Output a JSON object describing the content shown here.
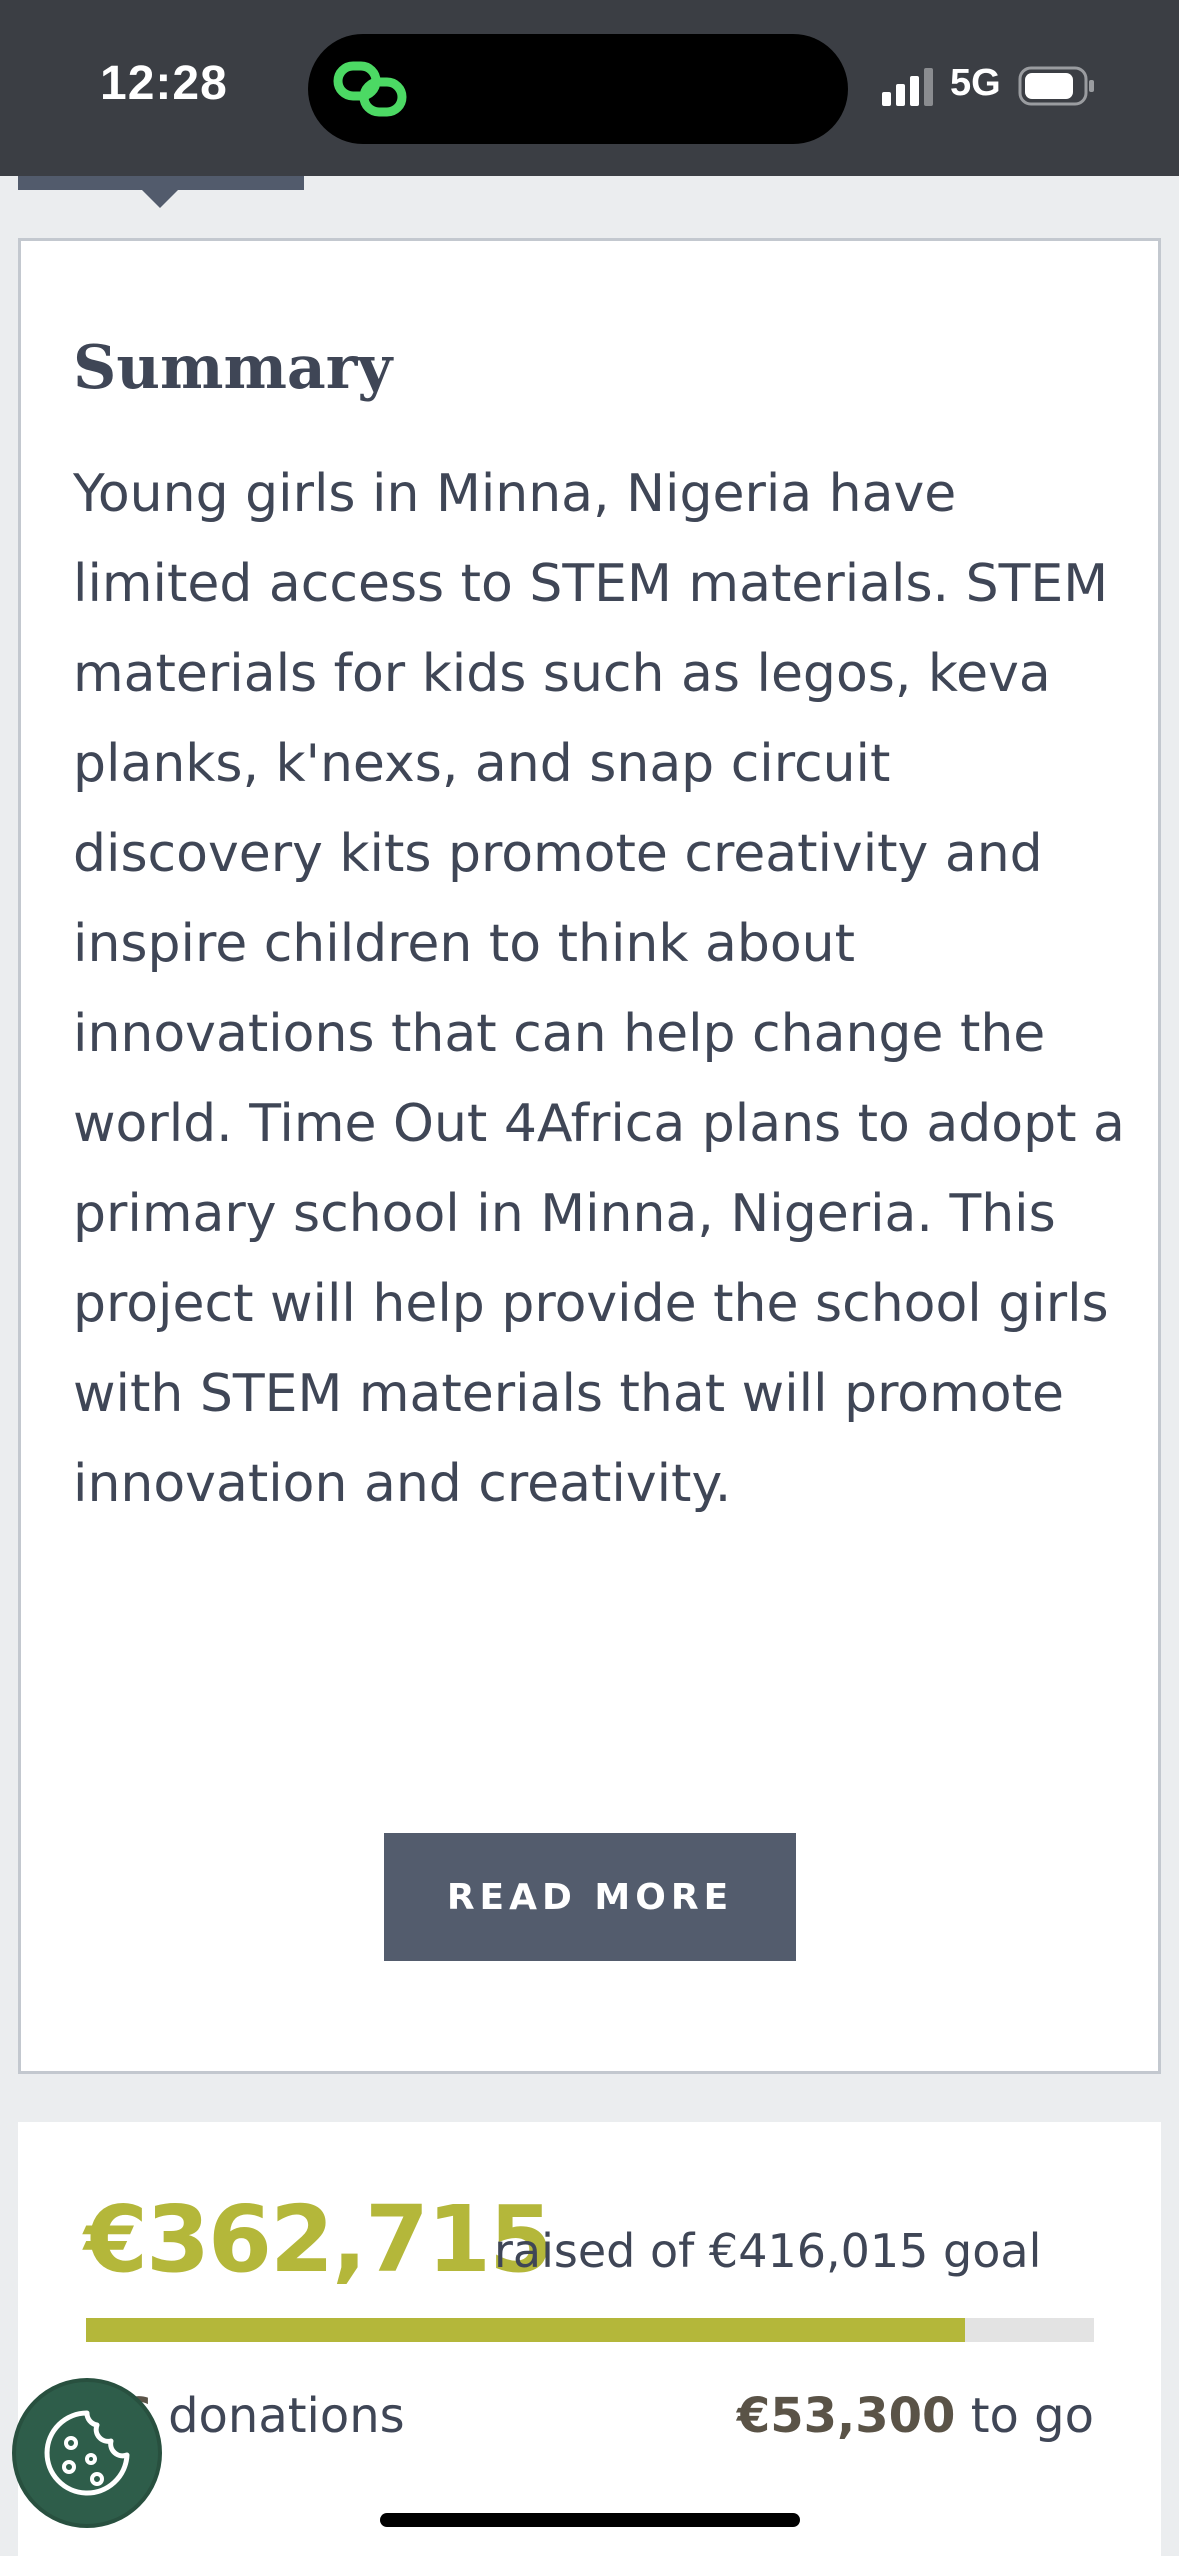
{
  "status_bar": {
    "time": "12:28",
    "network": "5G",
    "icons": [
      "link-icon",
      "signal-icon",
      "battery-icon"
    ]
  },
  "summary": {
    "title": "Summary",
    "text": "Young girls in Minna, Nigeria have limited access to STEM materials. STEM materials for kids such as legos, keva planks, k'nexs, and snap circuit discovery kits promote creativity and inspire children to think about innovations that can help change the world. Time Out 4Africa plans to adopt a primary school in Minna, Nigeria. This project will help provide the school girls with STEM materials that will promote innovation and creativity.",
    "read_more_label": "READ MORE"
  },
  "progress": {
    "raised": "€362,715",
    "raised_caption": "raised of €416,015 goal",
    "fraction_raised": 0.8719,
    "donations_count": "86",
    "donations_label": "donations",
    "to_go_amount": "€53,300",
    "to_go_label": "to go"
  },
  "colors": {
    "accent": "#b4b73a",
    "button": "#535c6d",
    "text": "#3f4656",
    "status_bar": "#3b3e44",
    "cookie": "#2e5d4a"
  },
  "cookie_button_icon": "cookie-icon"
}
